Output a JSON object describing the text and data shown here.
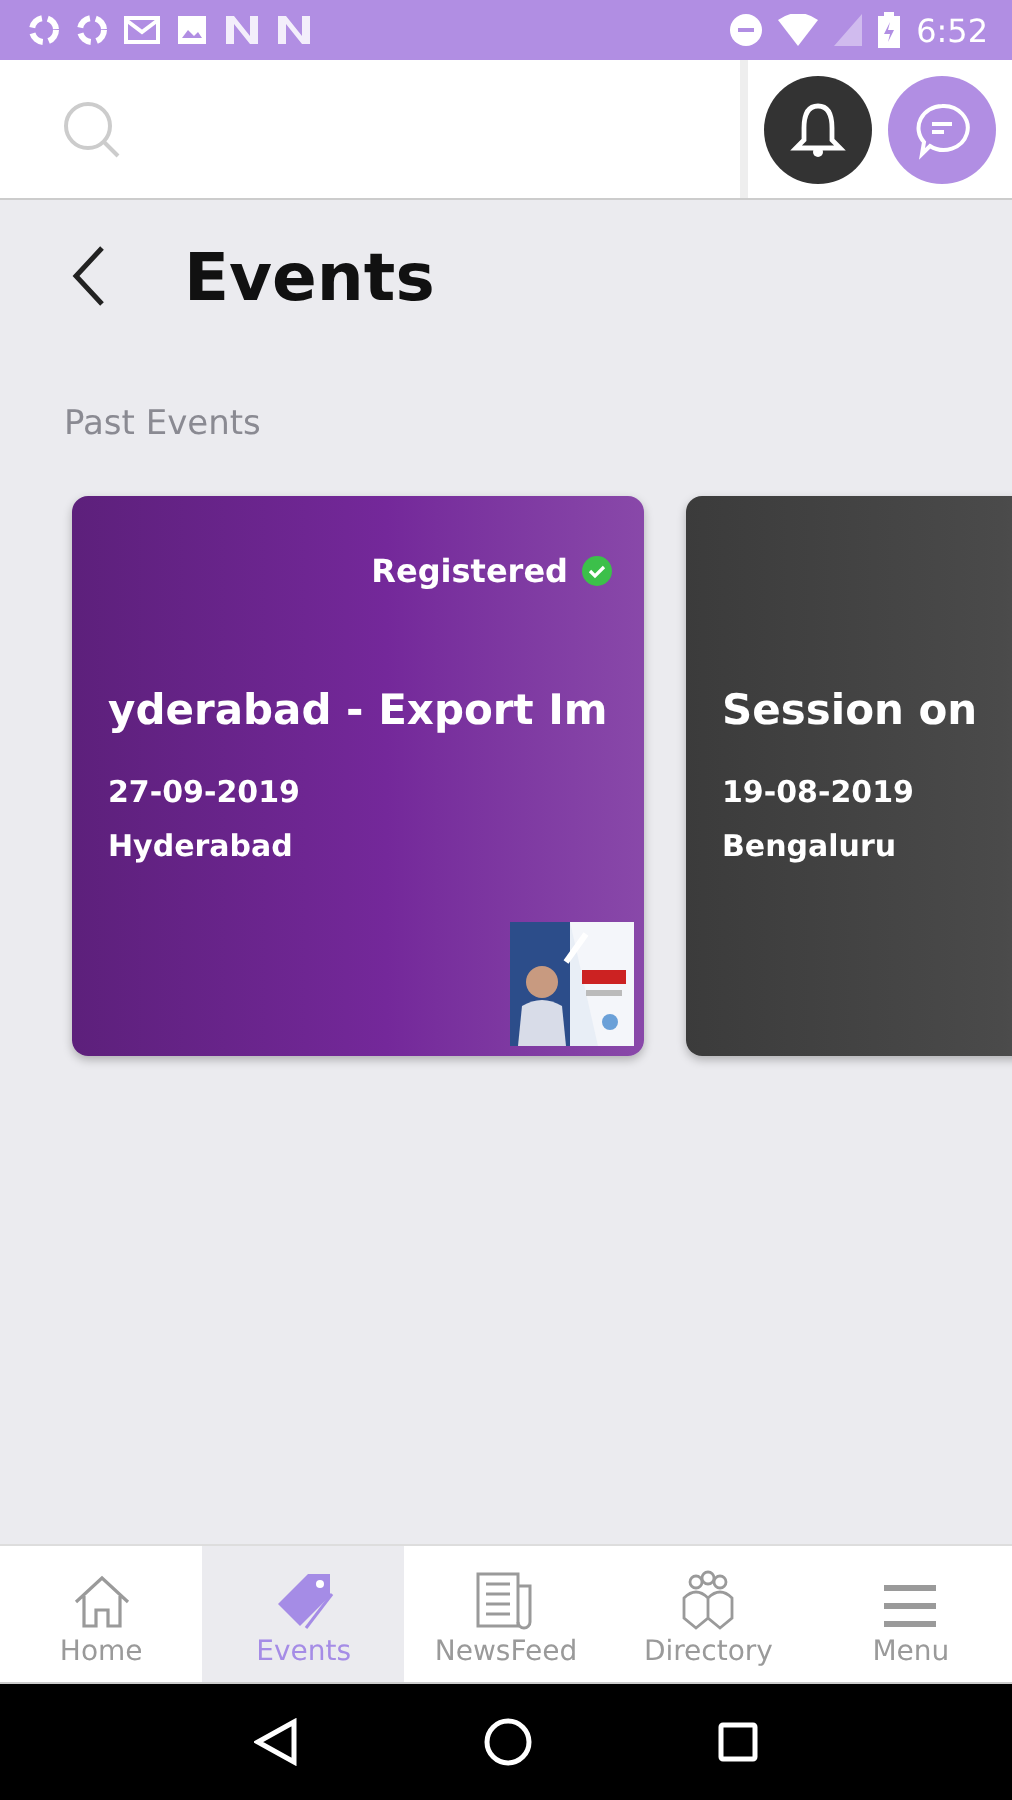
{
  "status_bar": {
    "time": "6:52"
  },
  "page": {
    "title": "Events",
    "section": "Past Events"
  },
  "events": [
    {
      "title": "yderabad - Export Im",
      "date": "27-09-2019",
      "city": "Hyderabad",
      "registered": true,
      "registered_label": "Registered",
      "color": "#74289a"
    },
    {
      "title": "Session on",
      "date": "19-08-2019",
      "city": "Bengaluru",
      "color": "#4a4a4a"
    }
  ],
  "bottom_nav": [
    {
      "label": "Home",
      "selected": false
    },
    {
      "label": "Events",
      "selected": true
    },
    {
      "label": "NewsFeed",
      "selected": false
    },
    {
      "label": "Directory",
      "selected": false
    },
    {
      "label": "Menu",
      "selected": false
    }
  ]
}
